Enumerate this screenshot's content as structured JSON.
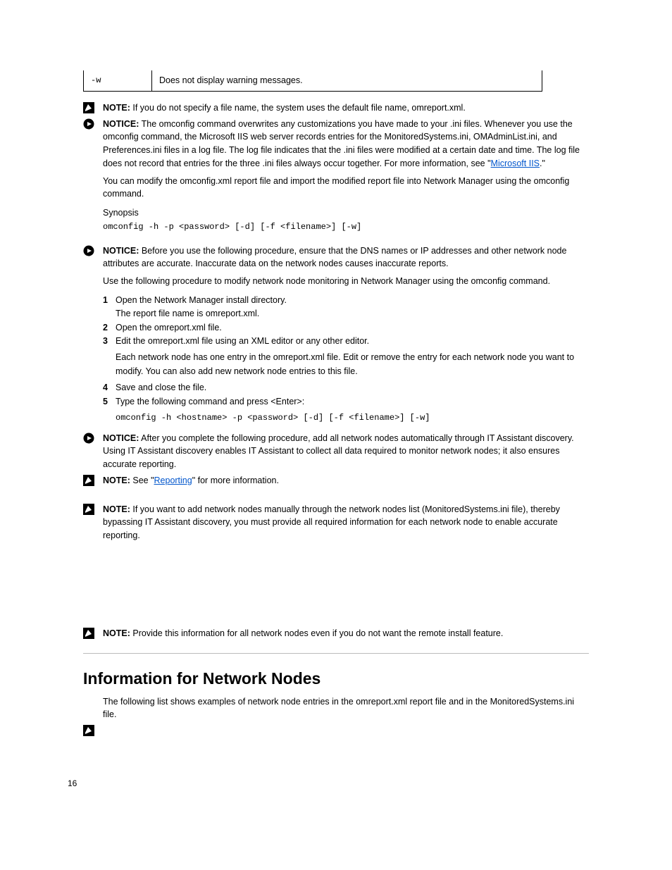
{
  "table": {
    "col1": "-w",
    "col2": "Does not display warning messages."
  },
  "notes": {
    "note1_label": "NOTE:",
    "note1_body": " If you do not specify a file name, the system uses the default file name, omreport.xml.",
    "notice1_label": "NOTICE:",
    "notice1_text_a": " The omconfig command overwrites any customizations you have made to your .ini files. Whenever you use the omconfig command, the Microsoft IIS web server records entries for the MonitoredSystems.ini, OMAdminList.ini, and Preferences.ini files in a log file. The log file indicates that the .ini files were modified at a certain date and time. The log file does not record that entries for the three .ini files always occur together. For more information, see \"",
    "notice1_link": "Microsoft IIS",
    "notice1_text_b": ".\"",
    "notice2_label": "NOTICE:",
    "notice2_body": " Before you use the following procedure, ensure that the DNS names or IP addresses and other network node attributes are accurate. Inaccurate data on the network nodes causes inaccurate reports.",
    "notice3_label": "NOTICE:",
    "notice3_body": " After you complete the following procedure, add all network nodes automatically through IT Assistant discovery. Using IT Assistant discovery enables IT Assistant to collect all data required to monitor network nodes; it also ensures accurate reporting.",
    "note2_label": "NOTE:",
    "note2_text_a": " See \"",
    "note2_link": "Reporting",
    "note2_text_b": "\" for more information.",
    "note3_label": "NOTE:",
    "note3_body": " If you want to add network nodes manually through the network nodes list (MonitoredSystems.ini file), thereby bypassing IT Assistant discovery, you must provide all required information for each network node to enable accurate reporting.",
    "note4_label": "NOTE:",
    "note4_body": " Provide this information for all network nodes even if you do not want the remote install feature."
  },
  "para1": "You can modify the omconfig.xml report file and import the modified report file into Network Manager using the omconfig command.",
  "synopsis_label": "Synopsis",
  "synopsis_code": "omconfig -h -p <password> [-d] [-f <filename>] [-w]",
  "para2": "Use the following procedure to modify network node monitoring in Network Manager using the omconfig command.",
  "steps": {
    "s1a": "Open the Network Manager install directory.",
    "s1b": "The report file name is omreport.xml.",
    "s2": "Open the omreport.xml file.",
    "s3": "Edit the omreport.xml file using an XML editor or any other editor.",
    "s3b": "Each network node has one entry in the omreport.xml file. Edit or remove the entry for each network node you want to modify. You can also add new network node entries to this file.",
    "s4": "Save and close the file.",
    "s5a": "Type the following command and press <Enter>:",
    "s5b": "omconfig -h <hostname> -p <password> [-d] [-f <filename>] [-w]"
  },
  "heading2": "Information for Network Nodes",
  "para3": "The following list shows examples of network node entries in the omreport.xml report file and in the MonitoredSystems.ini file.",
  "page_number": "16"
}
